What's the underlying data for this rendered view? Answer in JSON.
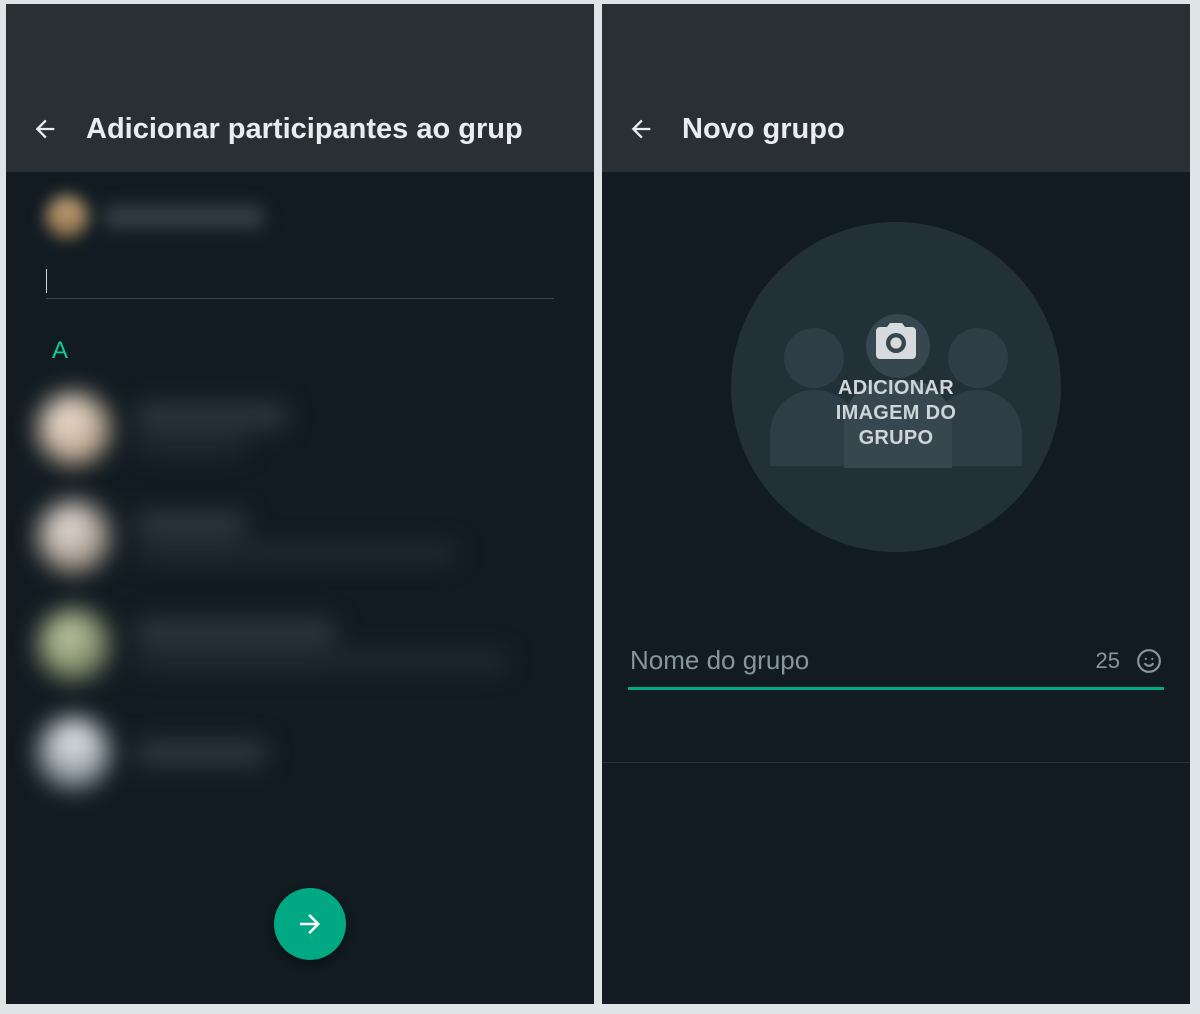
{
  "left": {
    "header_title": "Adicionar participantes ao grup",
    "section_letter": "A"
  },
  "right": {
    "header_title": "Novo grupo",
    "add_image_line1": "ADICIONAR",
    "add_image_line2": "IMAGEM DO",
    "add_image_line3": "GRUPO",
    "name_placeholder": "Nome do grupo",
    "char_remaining": "25"
  },
  "colors": {
    "accent": "#00a884",
    "bg": "#111b21",
    "header": "#2a2f33"
  }
}
